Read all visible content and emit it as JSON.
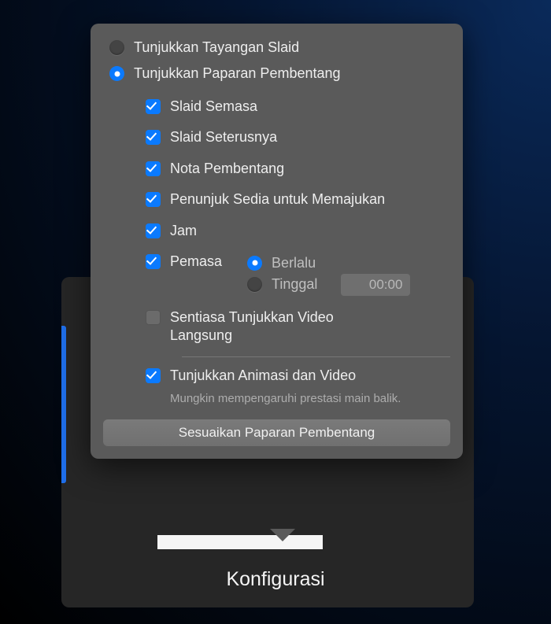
{
  "radios": {
    "slideshow": {
      "label": "Tunjukkan Tayangan Slaid",
      "selected": false
    },
    "presenter": {
      "label": "Tunjukkan Paparan Pembentang",
      "selected": true
    }
  },
  "checkboxes": {
    "current_slide": {
      "label": "Slaid Semasa",
      "checked": true
    },
    "next_slide": {
      "label": "Slaid Seterusnya",
      "checked": true
    },
    "presenter_notes": {
      "label": "Nota Pembentang",
      "checked": true
    },
    "ready_advance": {
      "label": "Penunjuk Sedia untuk Memajukan",
      "checked": true
    },
    "clock": {
      "label": "Jam",
      "checked": true
    },
    "timer": {
      "label": "Pemasa",
      "checked": true
    },
    "live_video": {
      "label": "Sentiasa Tunjukkan Video Langsung",
      "checked": false
    },
    "animations": {
      "label": "Tunjukkan Animasi dan Video",
      "checked": true
    }
  },
  "timer_options": {
    "elapsed": {
      "label": "Berlalu",
      "selected": true
    },
    "remaining": {
      "label": "Tinggal",
      "selected": false
    },
    "value": "00:00"
  },
  "helper": "Mungkin mempengaruhi prestasi main balik.",
  "customize_button": "Sesuaikan Paparan Pembentang",
  "footer_label": "Konfigurasi"
}
